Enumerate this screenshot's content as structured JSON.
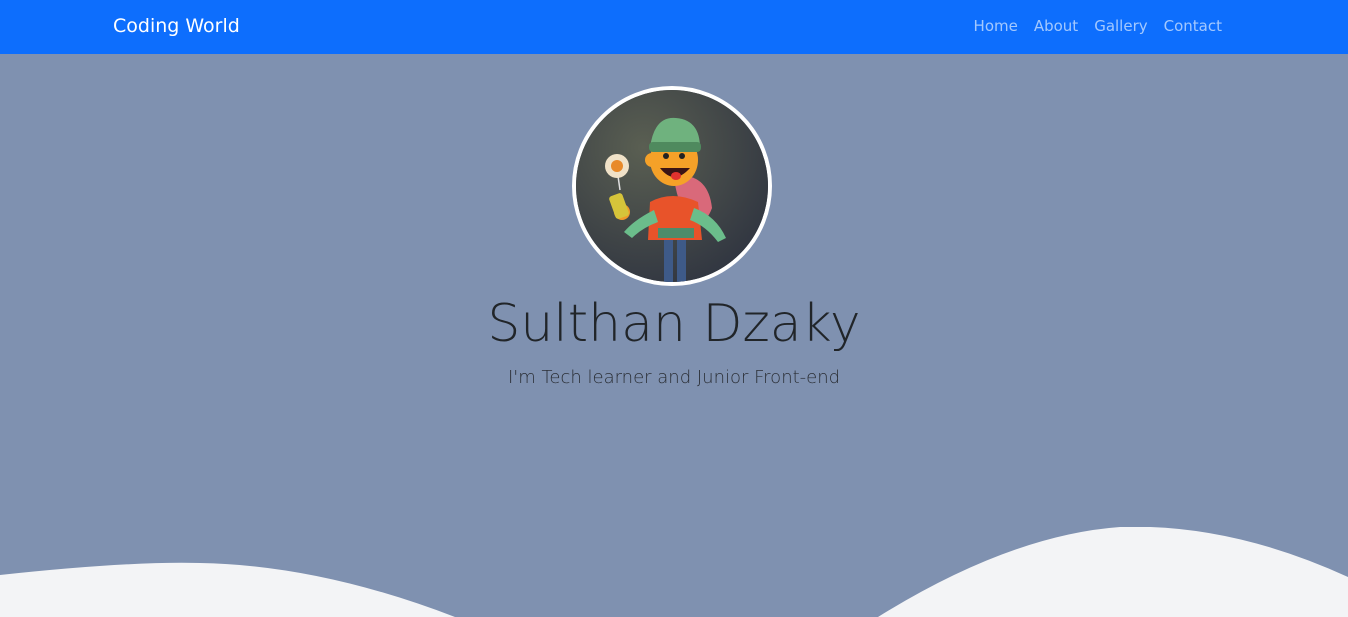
{
  "navbar": {
    "brand": "Coding World",
    "links": [
      {
        "label": "Home"
      },
      {
        "label": "About"
      },
      {
        "label": "Gallery"
      },
      {
        "label": "Contact"
      }
    ],
    "background": "#0d6efd"
  },
  "hero": {
    "title": "Sulthan Dzaky",
    "subtitle": "I'm Tech learner and Junior Front-end",
    "background": "#7f91b0",
    "wave_color": "#f3f4f6"
  }
}
